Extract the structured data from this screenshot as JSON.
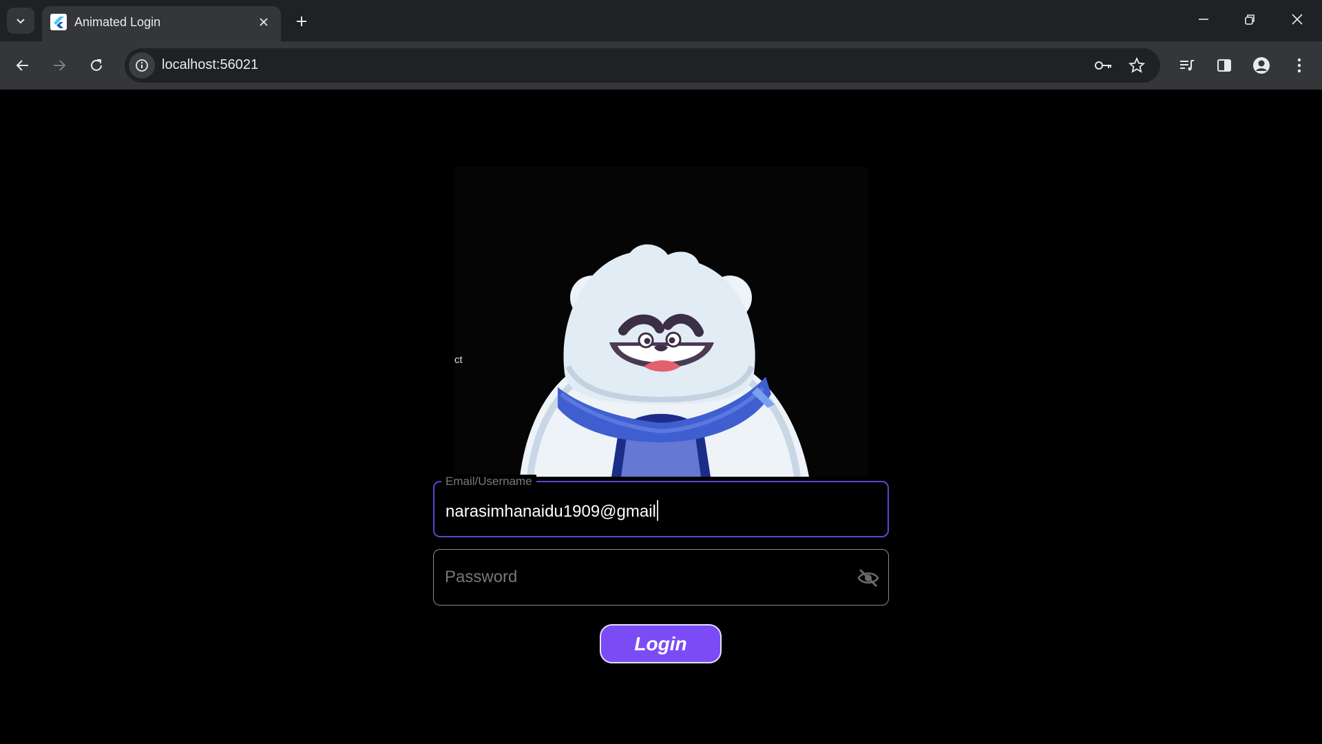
{
  "browser": {
    "tab_title": "Animated Login",
    "url": "localhost:56021",
    "icons": {
      "tab_search": "chevron-down-icon",
      "favicon": "flutter-logo-icon",
      "tab_close": "close-icon",
      "new_tab": "plus-icon",
      "minimize": "minimize-icon",
      "restore": "restore-icon",
      "close_window": "close-icon",
      "back": "arrow-left-icon",
      "forward": "arrow-right-icon",
      "reload": "reload-icon",
      "site_info": "info-icon",
      "passwords": "key-icon",
      "bookmark": "star-icon",
      "media": "media-queue-icon",
      "side_panel": "side-panel-icon",
      "profile": "person-icon",
      "menu": "kebab-menu-icon"
    }
  },
  "login": {
    "stray_text": "ct",
    "email": {
      "label": "Email/Username",
      "value": "narasimhanaidu1909@gmail"
    },
    "password": {
      "placeholder": "Password"
    },
    "login_button": "Login",
    "colors": {
      "accent": "#7b4cf5",
      "focus_border": "#5b47d6",
      "scarf": "#3f5fd0"
    }
  }
}
